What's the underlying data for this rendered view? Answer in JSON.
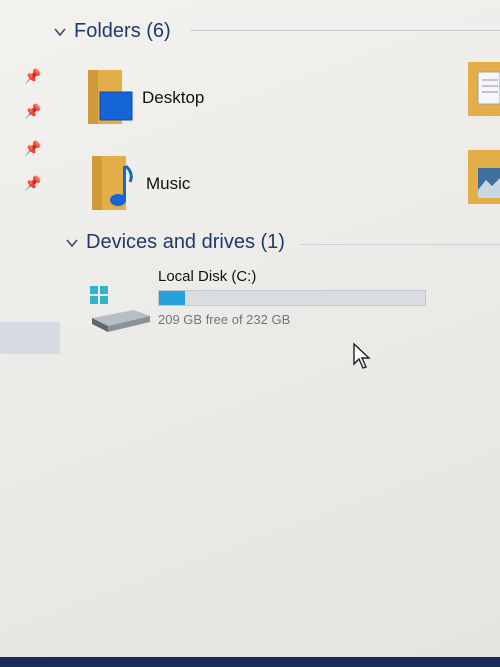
{
  "groups": {
    "folders": {
      "title": "Folders (6)"
    },
    "devices": {
      "title": "Devices and drives (1)"
    }
  },
  "folders": [
    {
      "label": "Desktop",
      "icon": "desktop-folder-icon"
    },
    {
      "label": "Music",
      "icon": "music-folder-icon"
    }
  ],
  "drive": {
    "name": "Local Disk (C:)",
    "free_text": "209 GB free of 232 GB",
    "used_fraction": 0.099,
    "icon": "drive-icon"
  },
  "colors": {
    "header_text": "#1e3a6e",
    "bar_fill": "#26a0da",
    "folder_yellow": "#e8b04a",
    "taskbar": "#1b2b5a"
  }
}
